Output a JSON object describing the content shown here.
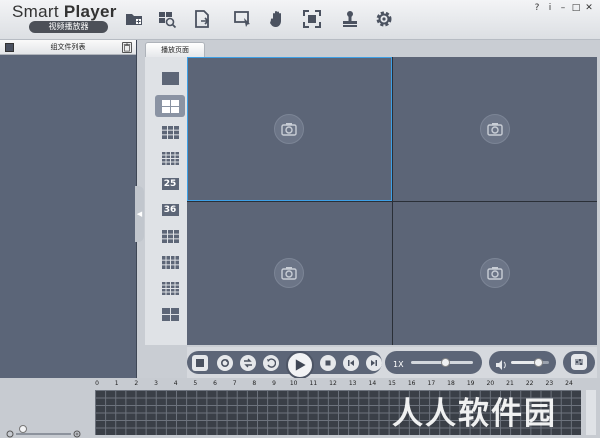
{
  "app": {
    "title_plain": "Smart ",
    "title_bold": "Player",
    "subtitle": "视频播放器"
  },
  "toolbar": {
    "icons": [
      "open-folder-icon",
      "search-video-icon",
      "export-file-icon",
      "select-area-icon",
      "hand-drag-icon",
      "fullscreen-icon",
      "stamp-icon",
      "settings-gear-icon"
    ]
  },
  "window_controls": {
    "help": "?",
    "info": "i",
    "minimize": "–",
    "maximize": "□",
    "close": "✕"
  },
  "file_panel": {
    "header": "组文件列表"
  },
  "tabs": [
    {
      "label": "播放页面"
    }
  ],
  "layouts": [
    {
      "name": "layout-1"
    },
    {
      "name": "layout-4"
    },
    {
      "name": "layout-9"
    },
    {
      "name": "layout-16"
    },
    {
      "name": "layout-25",
      "label": "25"
    },
    {
      "name": "layout-36",
      "label": "36"
    },
    {
      "name": "layout-6"
    },
    {
      "name": "layout-8"
    },
    {
      "name": "layout-13"
    },
    {
      "name": "layout-pip"
    }
  ],
  "selected_layout": "layout-4",
  "panes": 4,
  "active_pane": 0,
  "playback": {
    "speed_label": "1X",
    "speed_slider_level": 0.55,
    "volume_level": 0.7
  },
  "timeline": {
    "hours": [
      "0",
      "1",
      "2",
      "3",
      "4",
      "5",
      "6",
      "7",
      "8",
      "9",
      "10",
      "11",
      "12",
      "13",
      "14",
      "15",
      "16",
      "17",
      "18",
      "19",
      "20",
      "21",
      "22",
      "23",
      "24"
    ]
  },
  "watermark": "人人软件园",
  "colors": {
    "accent_active": "#3ea0e6",
    "pane_bg": "#5c6577"
  }
}
